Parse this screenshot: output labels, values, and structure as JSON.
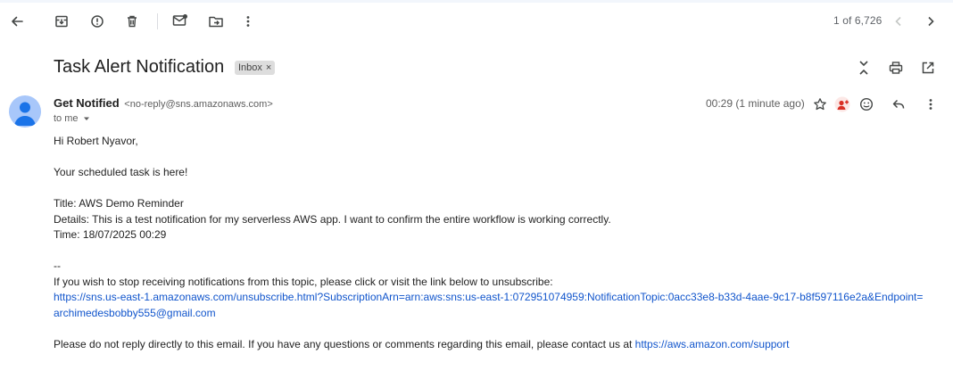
{
  "toolbar": {
    "back_icon": "arrow-left-icon",
    "actions": [
      "archive-icon",
      "report-spam-icon",
      "delete-icon",
      "mark-unread-icon",
      "move-to-icon",
      "more-vert-icon"
    ]
  },
  "pager": {
    "text": "1 of 6,726"
  },
  "message": {
    "subject": "Task Alert Notification",
    "label": "Inbox",
    "label_remove": "×",
    "sender_name": "Get Notified",
    "sender_email": "<no-reply@sns.amazonaws.com>",
    "to": "to me",
    "timestamp": "00:29 (1 minute ago)"
  },
  "body": {
    "greeting": "Hi Robert Nyavor,",
    "intro": "Your scheduled task is here!",
    "title_line": "Title: AWS Demo Reminder",
    "details_line": "Details: This is a test notification for my serverless AWS app. I want to confirm the entire workflow is working correctly.",
    "time_line": "Time: 18/07/2025 00:29",
    "separator": "--",
    "unsubscribe_text": "If you wish to stop receiving notifications from this topic, please click or visit the link below to unsubscribe:",
    "unsubscribe_link": "https://sns.us-east-1.amazonaws.com/unsubscribe.html?SubscriptionArn=arn:aws:sns:us-east-1:072951074959:NotificationTopic:0acc33e8-b33d-4aae-9c17-b8f597116e2a&Endpoint=",
    "unsubscribe_link_2": "archimedesbobby555@gmail.com",
    "footer_text": "Please do not reply directly to this email. If you have any questions or comments regarding this email, please contact us at ",
    "footer_link": "https://aws.amazon.com/support"
  },
  "colors": {
    "link": "#1155cc",
    "avatar_bg": "#a8c7fa",
    "avatar_fg": "#1a73e8",
    "chip_bg": "#dddddd",
    "top_band": "#f2f6fc"
  }
}
